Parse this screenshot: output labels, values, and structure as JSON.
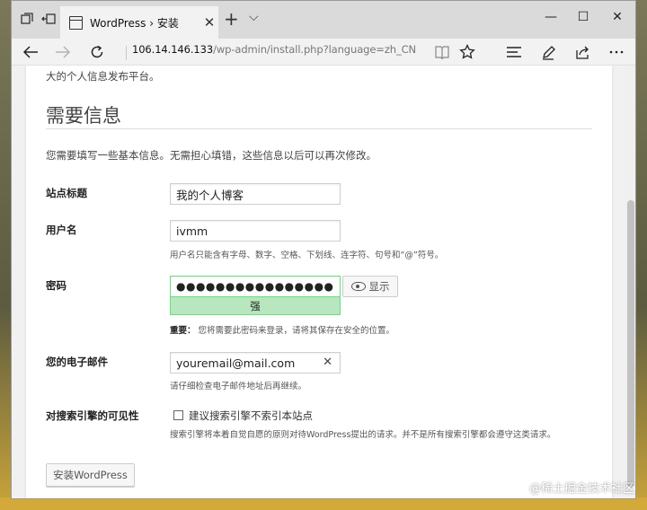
{
  "browser": {
    "tab_title": "WordPress › 安装",
    "tab_close": "✕",
    "new_tab": "+",
    "tab_menu": "⌵",
    "url_host": "106.14.146.133",
    "url_path": "/wp-admin/install.php?language=zh_CN",
    "window_controls": {
      "minimize": "—",
      "maximize": "☐",
      "close": "✕"
    }
  },
  "page": {
    "intro_tail": "大的个人信息发布平台。",
    "heading": "需要信息",
    "description": "您需要填写一些基本信息。无需担心填错，这些信息以后可以再次修改。",
    "site_title": {
      "label": "站点标题",
      "value": "我的个人博客"
    },
    "username": {
      "label": "用户名",
      "value": "ivmm",
      "hint": "用户名只能含有字母、数字、空格、下划线、连字符、句号和“@”符号。"
    },
    "password": {
      "label": "密码",
      "value": "●●●●●●●●●●●●●●●●",
      "strength": "强",
      "show_label": "显示",
      "hint_strong": "重要：",
      "hint": "您将需要此密码来登录，请将其保存在安全的位置。"
    },
    "email": {
      "label": "您的电子邮件",
      "value": "youremail@mail.com",
      "clear": "✕",
      "hint": "请仔细检查电子邮件地址后再继续。"
    },
    "visibility": {
      "label": "对搜索引擎的可见性",
      "checkbox_label": "建议搜索引擎不索引本站点",
      "checked": false,
      "hint": "搜索引擎将本着自觉自愿的原则对待WordPress提出的请求。并不是所有搜索引擎都会遵守这类请求。"
    },
    "install_button": "安装WordPress"
  },
  "watermark": "@稀土掘金技术社区"
}
